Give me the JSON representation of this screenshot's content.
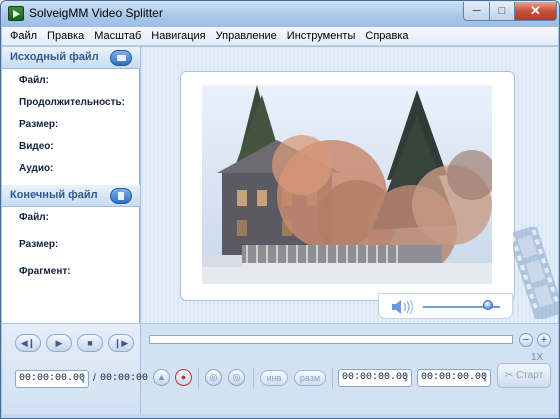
{
  "window": {
    "title": "SolveigMM Video Splitter",
    "minimize": "─",
    "maximize": "□",
    "close": "✕"
  },
  "menu": [
    "Файл",
    "Правка",
    "Масштаб",
    "Навигация",
    "Управление",
    "Инструменты",
    "Справка"
  ],
  "source": {
    "header": "Исходный файл",
    "fields": [
      "Файл:",
      "Продолжительность:",
      "Размер:",
      "Видео:",
      "Аудио:"
    ]
  },
  "output": {
    "header": "Конечный файл",
    "fields": [
      "Файл:",
      "Размер:",
      "Фрагмент:"
    ]
  },
  "volume": {
    "level": 0.85
  },
  "player": {
    "buttons": [
      "◀❙",
      "▶",
      "■",
      "❙▶"
    ],
    "current_time": "00:00:00.00",
    "separator": "/",
    "total_time": "00:00:00"
  },
  "timeline": {
    "zoom_out": "−",
    "zoom_in": "+",
    "zoom_level": "1X"
  },
  "fragment": {
    "btn_in": "инв",
    "btn_out": "разм",
    "start_time": "00:00:00.00",
    "end_time": "00:00:00.00",
    "start_button": "✂ Старт"
  },
  "icons": {
    "marker-in": "▲",
    "record": "●",
    "prev-marker": "◎",
    "next-marker": "◎"
  }
}
